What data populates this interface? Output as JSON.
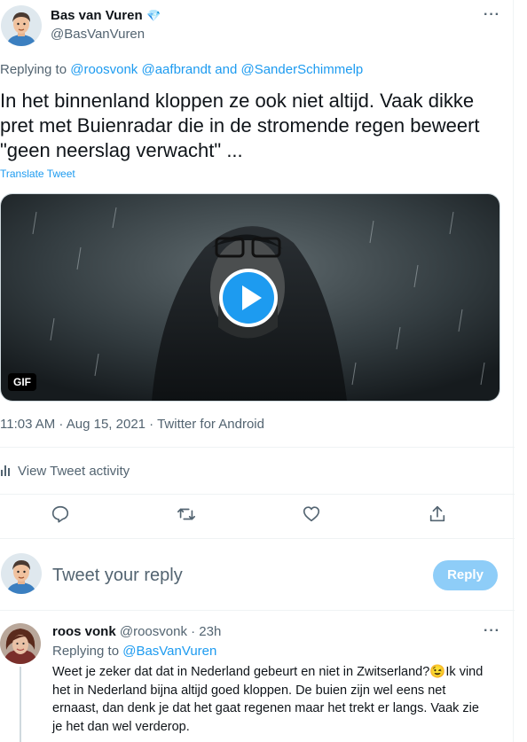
{
  "tweet": {
    "author_name": "Bas van Vuren",
    "author_badge": "💎",
    "author_handle": "@BasVanVuren",
    "replying_prefix": "Replying to",
    "replying_to": [
      "@roosvonk",
      "@aafbrandt",
      "@SanderSchimmelp"
    ],
    "replying_and": "and",
    "text_lines": [
      "In het binnenland kloppen ze ook niet altijd. Vaak dikke",
      "pret met Buienradar die in de stromende regen beweert",
      "\"geen neerslag verwacht\" ..."
    ],
    "translate_label": "Translate Tweet",
    "media": {
      "badge": "GIF",
      "icon": "play-icon"
    },
    "timestamp": "11:03 AM · Aug 15, 2021 · Twitter for Android",
    "activity_label": "View Tweet activity",
    "actions": [
      "reply-icon",
      "retweet-icon",
      "like-icon",
      "share-icon"
    ]
  },
  "reply_box": {
    "placeholder": "Tweet your reply",
    "button_label": "Reply"
  },
  "reply": {
    "author_name": "roos vonk",
    "author_handle": "@roosvonk",
    "time": "· 23h",
    "replying_prefix": "Replying to",
    "replying_to": "@BasVanVuren",
    "line1_a": "Weet je zeker dat dat in Nederland gebeurt en niet in Zwitserland?",
    "emoji": "😉",
    "line1_b": "Ik vind",
    "lines": [
      "het in Nederland bijna altijd goed kloppen. De buien zijn wel eens net",
      "ernaast, dan denk je dat het gaat regenen maar het trekt er langs. Vaak zie",
      "je het dan wel verderop."
    ]
  },
  "colors": {
    "accent": "#1d9bf0",
    "reply_button": "#8ecdf8",
    "muted": "#536471"
  }
}
